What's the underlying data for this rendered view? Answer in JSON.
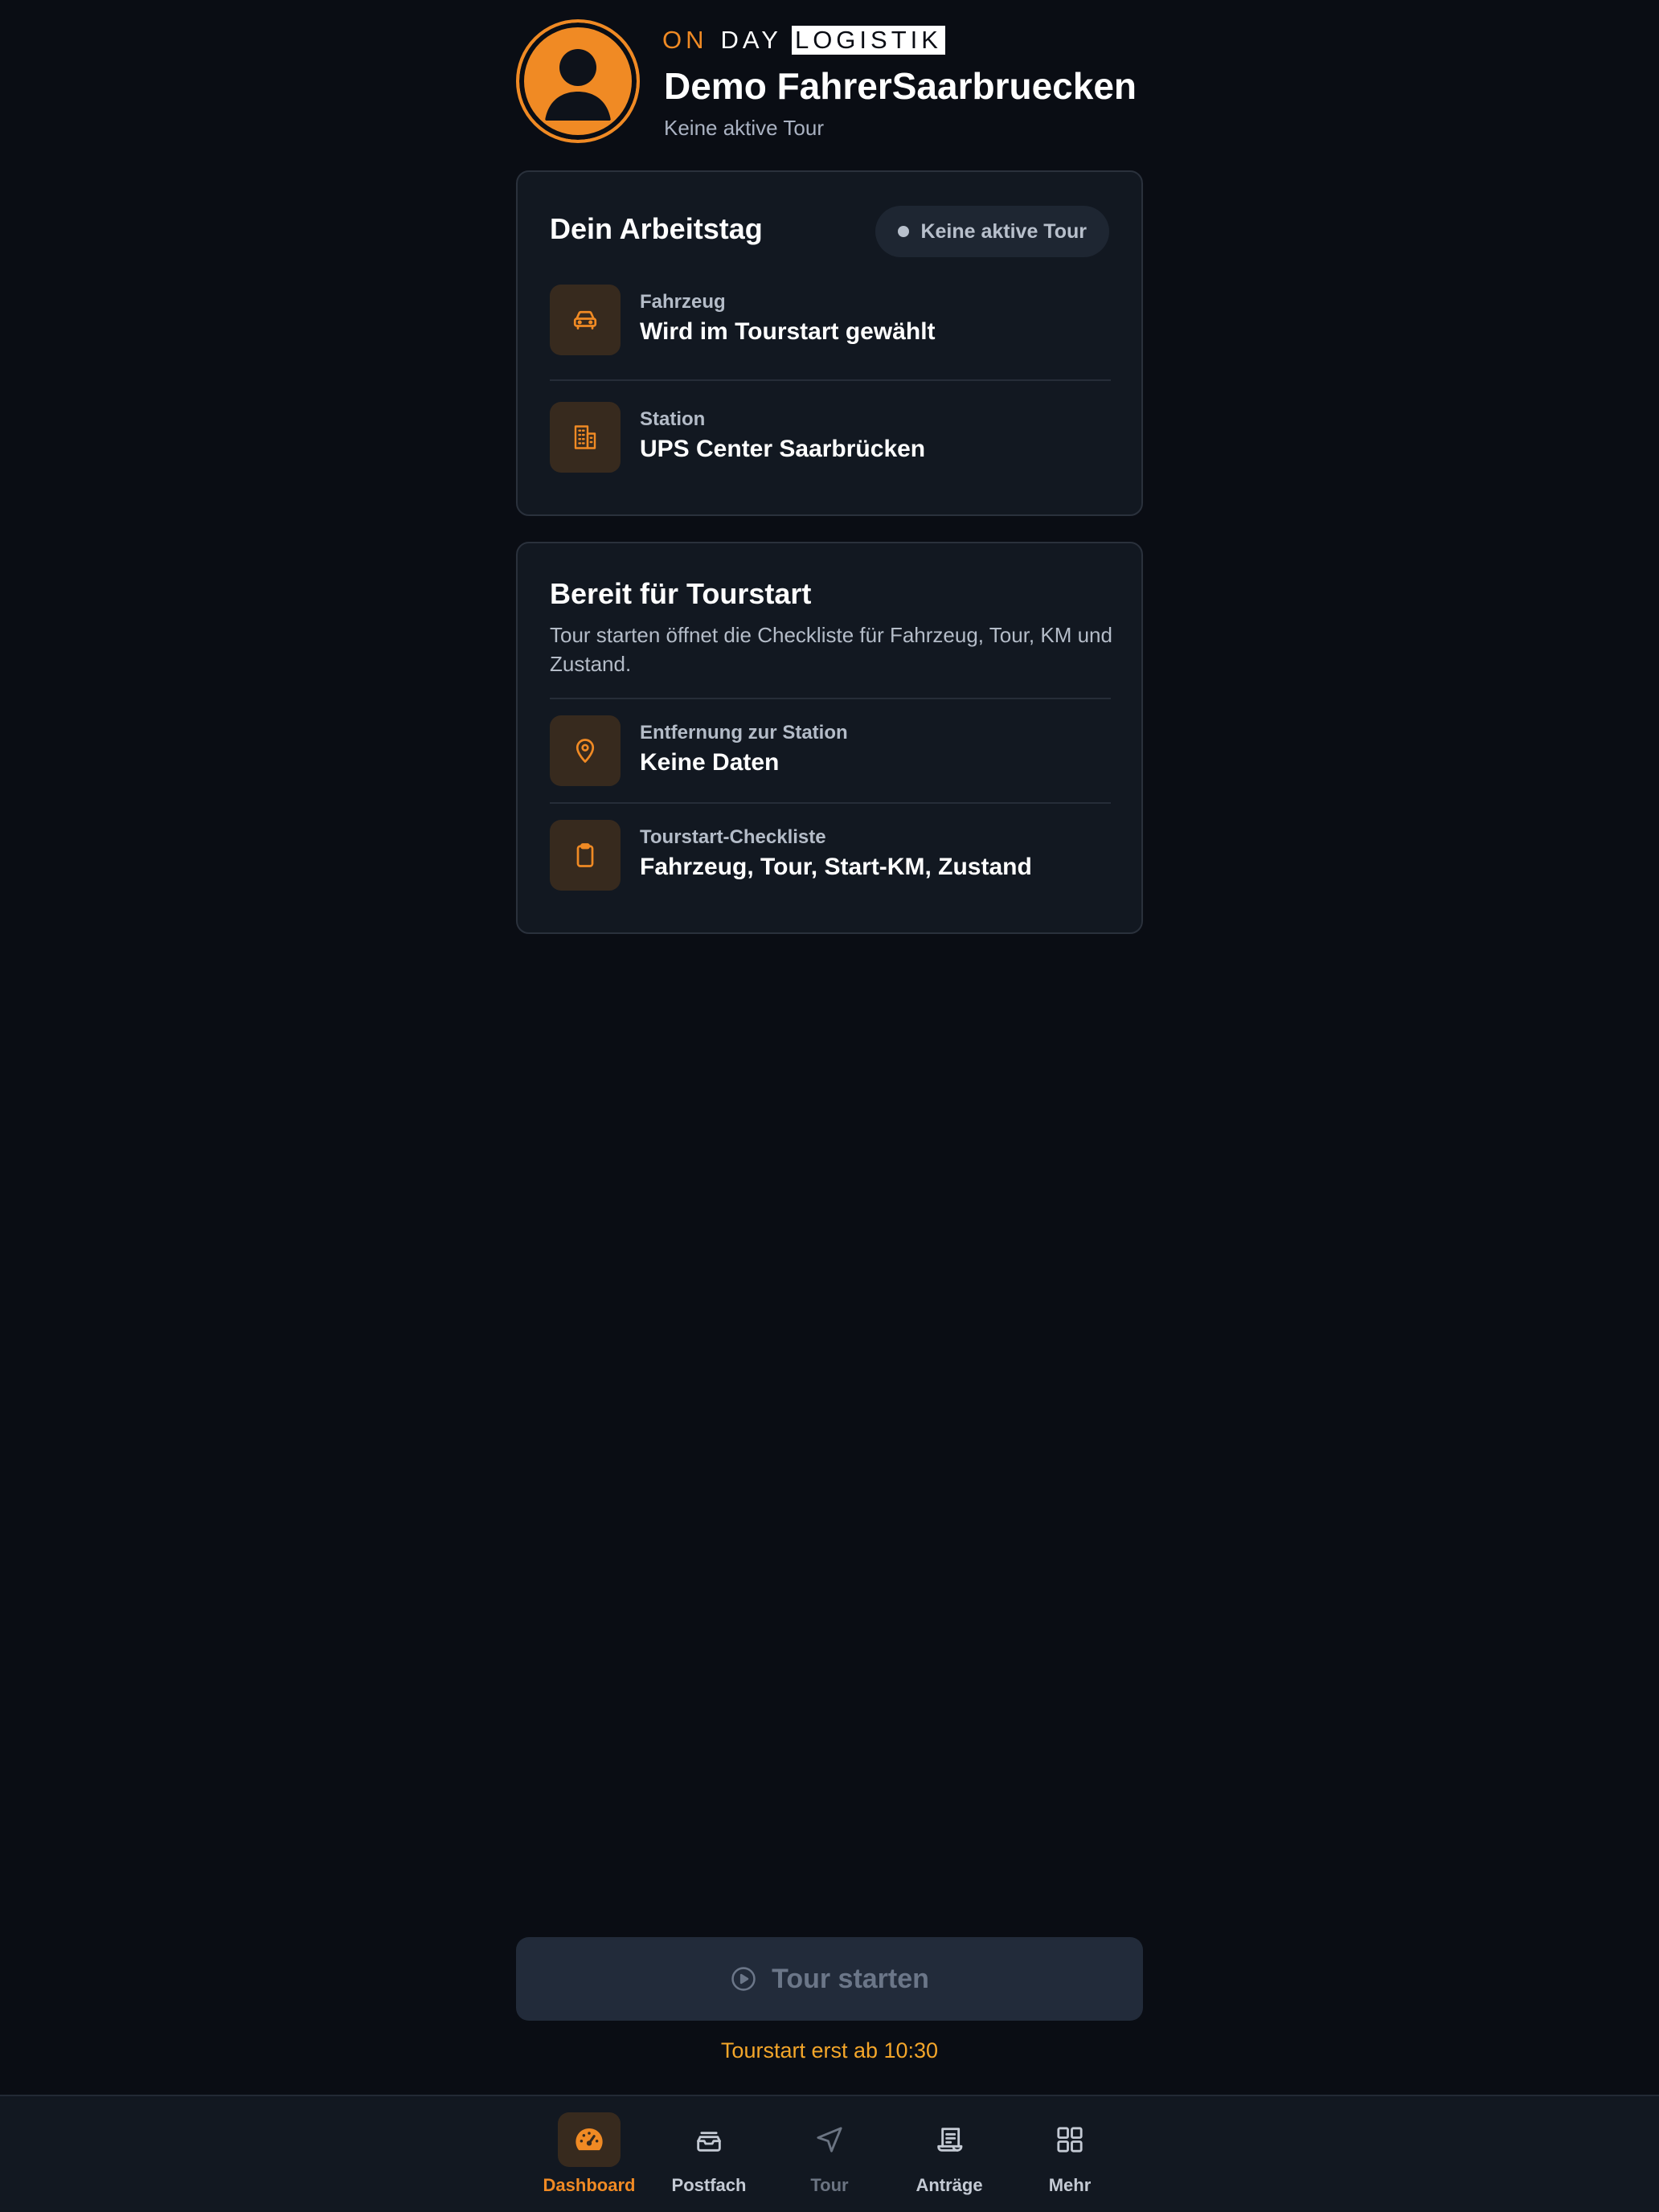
{
  "header": {
    "brand_on": "ON",
    "brand_day": "DAY",
    "brand_logistik": "LOGISTIK",
    "driver_name": "Demo FahrerSaarbruecken",
    "status": "Keine aktive Tour"
  },
  "workday": {
    "title": "Dein Arbeitstag",
    "status_pill": "Keine aktive Tour",
    "vehicle_label": "Fahrzeug",
    "vehicle_value": "Wird im Tourstart gewählt",
    "station_label": "Station",
    "station_value": "UPS Center Saarbrücken"
  },
  "ready": {
    "title": "Bereit für Tourstart",
    "description": "Tour starten öffnet die Checkliste für Fahrzeug, Tour, KM und Zustand.",
    "distance_label": "Entfernung zur Station",
    "distance_value": "Keine Daten",
    "checklist_label": "Tourstart-Checkliste",
    "checklist_value": "Fahrzeug, Tour, Start-KM, Zustand"
  },
  "start": {
    "button_label": "Tour starten",
    "hint": "Tourstart erst ab 10:30"
  },
  "nav": {
    "items": [
      {
        "label": "Dashboard",
        "icon": "speedometer-icon",
        "state": "active"
      },
      {
        "label": "Postfach",
        "icon": "inbox-icon",
        "state": "normal"
      },
      {
        "label": "Tour",
        "icon": "navigation-arrow-icon",
        "state": "disabled"
      },
      {
        "label": "Anträge",
        "icon": "document-scroll-icon",
        "state": "normal"
      },
      {
        "label": "Mehr",
        "icon": "grid-icon",
        "state": "normal"
      }
    ]
  },
  "colors": {
    "background": "#0a0d14",
    "card": "#121821",
    "accent": "#f08a24",
    "hint": "#f4a62a",
    "muted": "#b4bcc8"
  }
}
